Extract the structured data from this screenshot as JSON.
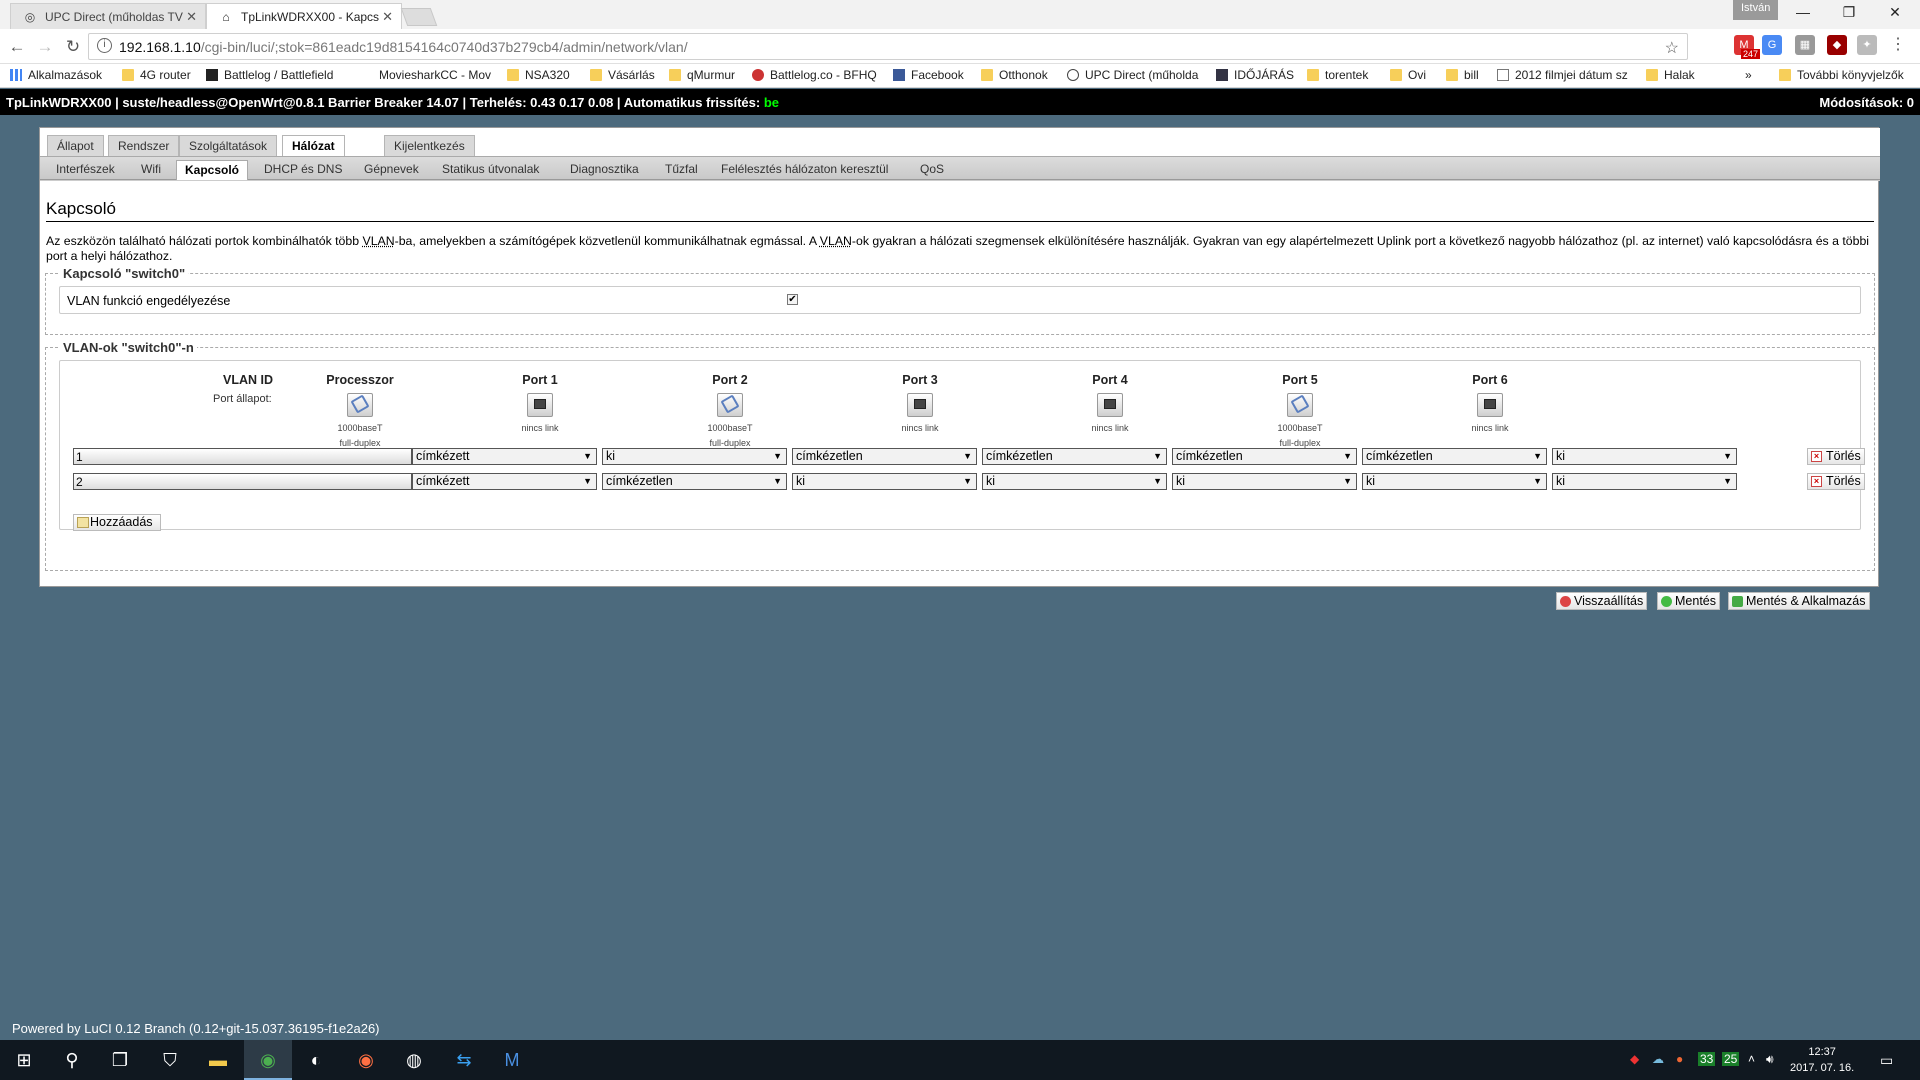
{
  "browser": {
    "tabs": [
      {
        "title": "UPC Direct (műholdas TV",
        "active": false
      },
      {
        "title": "TpLinkWDRXX00 - Kapcs",
        "active": true
      }
    ],
    "profile": "István",
    "url_host": "192.168.1.10",
    "url_path": "/cgi-bin/luci/;stok=861eadc19d8154164c0740d37b279cb4/admin/network/vlan/",
    "ext_badge": "247",
    "bookmarks": [
      {
        "label": "Alkalmazások",
        "icon": "apps-grid-icon"
      },
      {
        "label": "4G router",
        "icon": "folder-icon"
      },
      {
        "label": "Battlelog / Battlefield",
        "icon": "battlelog-icon"
      },
      {
        "label": "MoviesharkCC - Mov",
        "icon": "page-icon"
      },
      {
        "label": "NSA320",
        "icon": "folder-icon"
      },
      {
        "label": "Vásárlás",
        "icon": "folder-icon"
      },
      {
        "label": "qMurmur",
        "icon": "folder-icon"
      },
      {
        "label": "Battlelog.co - BFHQ",
        "icon": "battlelog-icon"
      },
      {
        "label": "Facebook",
        "icon": "facebook-icon"
      },
      {
        "label": "Otthonok",
        "icon": "folder-icon"
      },
      {
        "label": "UPC Direct (műholda",
        "icon": "upc-icon"
      },
      {
        "label": "IDŐJÁRÁS",
        "icon": "shield-icon"
      },
      {
        "label": "torentek",
        "icon": "folder-icon"
      },
      {
        "label": "Ovi",
        "icon": "folder-icon"
      },
      {
        "label": "bill",
        "icon": "folder-icon"
      },
      {
        "label": "2012 filmjei dátum sz",
        "icon": "page-icon"
      },
      {
        "label": "Halak",
        "icon": "folder-icon"
      }
    ],
    "bookmarks_more": "»",
    "other_bookmarks": "További könyvjelzők"
  },
  "luci": {
    "header_text": "TpLinkWDRXX00 | suste/headless@OpenWrt@0.8.1 Barrier Breaker 14.07 | Terhelés: 0.43 0.17 0.08 | Automatikus frissítés: ",
    "autorefresh": "be",
    "changes": "Módosítások: 0",
    "main_tabs": [
      "Állapot",
      "Rendszer",
      "Szolgáltatások",
      "Hálózat",
      "Kijelentkezés"
    ],
    "active_main_tab": "Hálózat",
    "sub_tabs": [
      "Interfészek",
      "Wifi",
      "Kapcsoló",
      "DHCP és DNS",
      "Gépnevek",
      "Statikus útvonalak",
      "Diagnosztika",
      "Tűzfal",
      "Felélesztés hálózaton keresztül",
      "QoS"
    ],
    "active_sub_tab": "Kapcsoló",
    "page_title": "Kapcsoló",
    "description_parts": [
      "Az eszközön található hálózati portok kombinálhatók több ",
      "VLAN",
      "-ba, amelyekben a számítógépek közvetlenül kommunikálhatnak egmással. A ",
      "VLAN",
      "-ok gyakran a hálózati szegmensek elkülönítésére használják. Gyakran van egy alapértelmezett Uplink port a következő nagyobb hálózathoz (pl. az internet) való kapcsolódásra és a többi port a helyi hálózathoz."
    ],
    "switch_section": {
      "legend": "Kapcsoló \"switch0\"",
      "option_label": "VLAN funkció engedélyezése",
      "checked": true
    },
    "vlan_section": {
      "legend": "VLAN-ok \"switch0\"-n",
      "vlan_id_header": "VLAN ID",
      "port_state_label": "Port állapot:",
      "ports": [
        {
          "name": "Processzor",
          "linked": true,
          "status1": "1000baseT",
          "status2": "full-duplex"
        },
        {
          "name": "Port 1",
          "linked": false,
          "status1": "nincs link",
          "status2": ""
        },
        {
          "name": "Port 2",
          "linked": true,
          "status1": "1000baseT",
          "status2": "full-duplex"
        },
        {
          "name": "Port 3",
          "linked": false,
          "status1": "nincs link",
          "status2": ""
        },
        {
          "name": "Port 4",
          "linked": false,
          "status1": "nincs link",
          "status2": ""
        },
        {
          "name": "Port 5",
          "linked": true,
          "status1": "1000baseT",
          "status2": "full-duplex"
        },
        {
          "name": "Port 6",
          "linked": false,
          "status1": "nincs link",
          "status2": ""
        }
      ],
      "rows": [
        {
          "vlan_id": "1",
          "values": [
            "címkézett",
            "ki",
            "címkézetlen",
            "címkézetlen",
            "címkézetlen",
            "címkézetlen",
            "ki"
          ]
        },
        {
          "vlan_id": "2",
          "values": [
            "címkézett",
            "címkézetlen",
            "ki",
            "ki",
            "ki",
            "ki",
            "ki"
          ]
        }
      ],
      "delete_label": "Törlés",
      "add_label": "Hozzáadás"
    },
    "actions": {
      "reset": "Visszaállítás",
      "save": "Mentés",
      "save_apply": "Mentés & Alkalmazás"
    },
    "footer": "Powered by LuCI 0.12 Branch (0.12+git-15.037.36195-f1e2a26)"
  },
  "taskbar": {
    "tray_numbers": [
      "33",
      "25"
    ],
    "time": "12:37",
    "date": "2017. 07. 16."
  },
  "colors": {
    "desktop_bg": "#4c6a7d",
    "header_bg": "#000000",
    "autorefresh": "#00ff00"
  }
}
